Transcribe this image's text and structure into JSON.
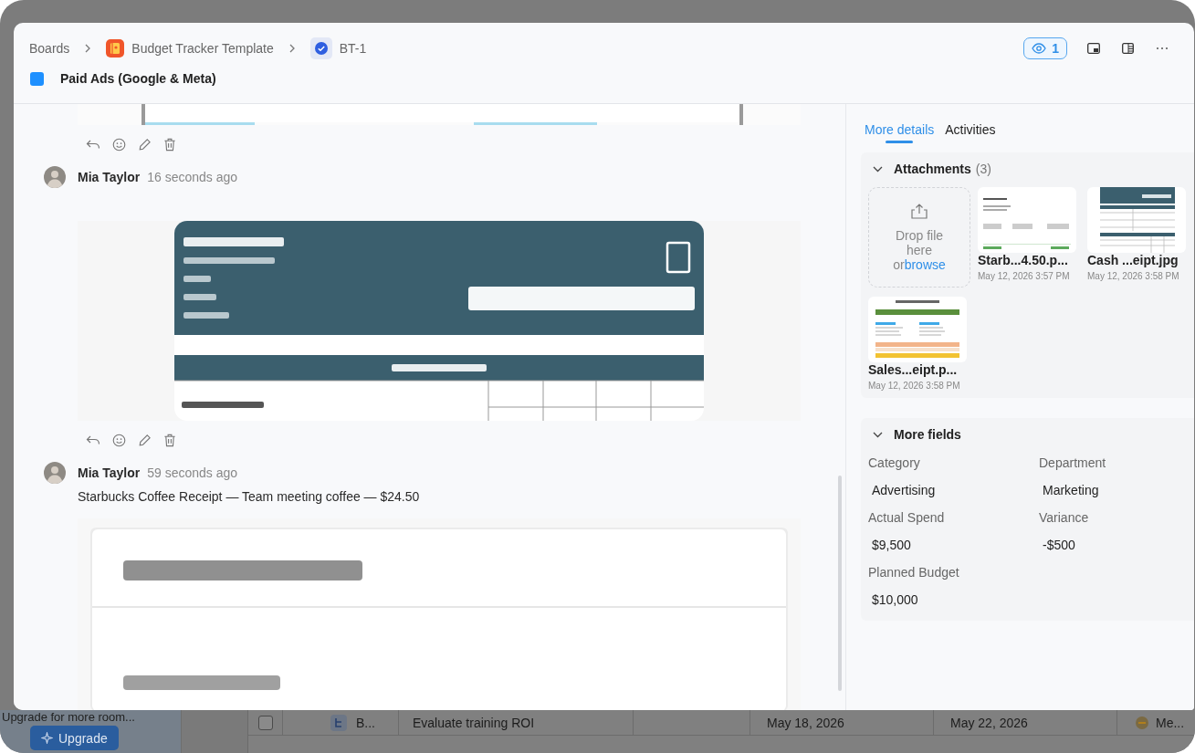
{
  "background": {
    "sidebar": {
      "upgrade_note": "Upgrade for more room...",
      "upgrade_button": "Upgrade"
    },
    "table_row": {
      "checked": false,
      "id": "B...",
      "name": "Evaluate training ROI",
      "start": "May 18, 2026",
      "end": "May 22, 2026",
      "assignee": "Me..."
    }
  },
  "breadcrumb": [
    {
      "kind": "text",
      "label": "Boards"
    },
    {
      "kind": "board",
      "label": "Budget Tracker Template"
    },
    {
      "kind": "task",
      "label": "BT-1"
    }
  ],
  "task": {
    "title": "Paid Ads (Google & Meta)"
  },
  "watchers": {
    "count": "1"
  },
  "feed": [
    {
      "kind": "picture"
    },
    {
      "kind": "actions"
    },
    {
      "kind": "comment",
      "author": "Mia Taylor",
      "time": "16 seconds ago",
      "attachment": {
        "kind": "picture"
      }
    },
    {
      "kind": "actions"
    },
    {
      "kind": "comment",
      "author": "Mia Taylor",
      "time": "59 seconds ago",
      "text": "Starbucks Coffee Receipt — Team meeting coffee — $24.50",
      "attachment": {
        "kind": "picture"
      }
    }
  ],
  "tabs": [
    {
      "label": "More details",
      "selected": true
    },
    {
      "label": "Activities",
      "selected": false
    }
  ],
  "attachments": {
    "title": "Attachments",
    "count": "(3)",
    "expanded": true,
    "drop_text": "Drop file here or",
    "drop_link": "browse",
    "files": [
      {
        "name": "Starb...4.50.p...",
        "date": "May 12, 2026 3:57 PM"
      },
      {
        "name": "Cash ...eipt.jpg",
        "date": "May 12, 2026 3:58 PM"
      },
      {
        "name": "Sales...eipt.p...",
        "date": "May 12, 2026 3:58 PM"
      }
    ]
  },
  "more_fields": {
    "title": "More fields",
    "expanded": true,
    "fields": [
      {
        "label": "Category",
        "value": "Advertising"
      },
      {
        "label": "Department",
        "value": "Marketing"
      },
      {
        "label": "Actual Spend",
        "value": "$9,500"
      },
      {
        "label": "Variance",
        "value": "-$500"
      },
      {
        "label": "Planned Budget",
        "value": "$10,000"
      }
    ]
  }
}
